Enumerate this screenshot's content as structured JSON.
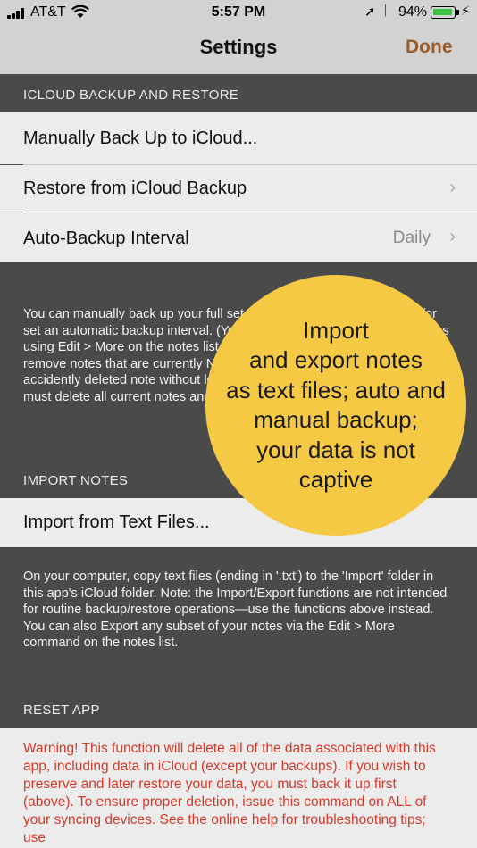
{
  "status_bar": {
    "carrier": "AT&T",
    "time": "5:57 PM",
    "battery_percent": "94%",
    "icons": [
      "signal-icon",
      "wifi-icon",
      "location-icon",
      "bluetooth-icon",
      "battery-icon",
      "charging-icon"
    ]
  },
  "nav": {
    "title": "Settings",
    "done_label": "Done"
  },
  "sections": {
    "backup": {
      "header": "ICLOUD BACKUP AND RESTORE",
      "items": [
        {
          "label": "Manually Back Up to iCloud..."
        },
        {
          "label": "Restore from iCloud Backup"
        },
        {
          "label": "Auto-Backup Interval",
          "value": "Daily"
        }
      ],
      "footer": "You can manually back up your full set of notes and data anytime and/or set an automatic backup interval. (You can back up a selected set of notes using Edit > More on the notes list.) Restoring any backup will completely remove notes that are currently NOT in the backup. You can recover an accidently deleted note without losing your current notes, but it means you must delete all current notes and replace with backed-up versions."
    },
    "import": {
      "header": "IMPORT NOTES",
      "items": [
        {
          "label": "Import from Text Files..."
        }
      ],
      "footer": "On your computer, copy text files (ending in '.txt') to the 'Import' folder in this app's iCloud folder. Note: the Import/Export functions are not intended for routine backup/restore operations—use the functions above instead. You can also Export any subset of your notes via the Edit > More command on the notes list."
    },
    "reset": {
      "header": "RESET APP",
      "warning": "Warning! This function will delete all of the data associated with this app, including data in iCloud (except your backups).  If you wish to preserve and later restore your data, you must back it up first (above).  To ensure proper deletion, issue this command on ALL of your syncing devices. See the online help for troubleshooting tips; use"
    }
  },
  "callout": {
    "text": "Import\nand export notes\nas text files; auto and\nmanual backup;\nyour data is not\ncaptive",
    "color": "#f6c945"
  },
  "colors": {
    "accent": "#9a5c28",
    "warning": "#d33a2a",
    "background": "#4a4a4a"
  }
}
